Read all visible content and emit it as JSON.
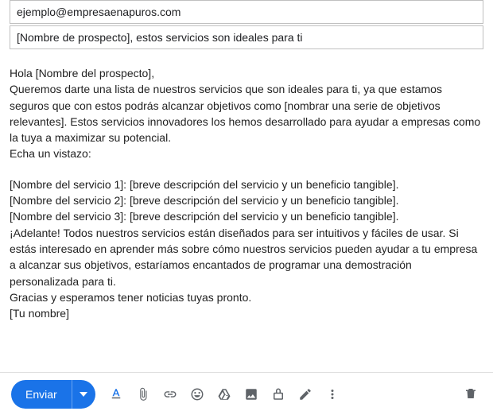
{
  "header": {
    "to": "ejemplo@empresaenapuros.com",
    "subject": "[Nombre de prospecto], estos servicios son ideales para ti"
  },
  "body": {
    "greeting": "Hola [Nombre del prospecto],",
    "intro": "Queremos darte una lista de nuestros servicios que son ideales para ti, ya que estamos seguros que con estos podrás alcanzar objetivos como [nombrar una serie de objetivos relevantes]. Estos servicios innovadores los hemos desarrollado para ayudar a empresas como la tuya a maximizar su potencial.",
    "look": "Echa un vistazo:",
    "services": [
      "[Nombre del servicio 1]: [breve descripción del servicio y un beneficio tangible].",
      "[Nombre del servicio 2]: [breve descripción del servicio y un beneficio tangible].",
      "[Nombre del servicio 3]: [breve descripción del servicio y un beneficio tangible]."
    ],
    "cta": "¡Adelante! Todos nuestros servicios están diseñados para ser intuitivos y fáciles de usar. Si estás interesado en aprender más sobre cómo nuestros servicios pueden ayudar a tu empresa a alcanzar sus objetivos, estaríamos encantados de programar una demostración personalizada para ti.",
    "closing1": "Gracias y esperamos tener noticias tuyas pronto.",
    "closing2": "[Tu nombre]"
  },
  "toolbar": {
    "send_label": "Enviar"
  }
}
